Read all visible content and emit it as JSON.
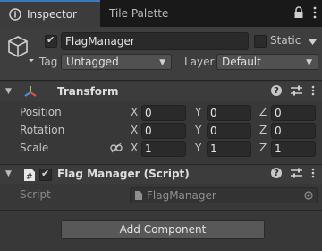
{
  "tabs": [
    {
      "label": "Inspector"
    },
    {
      "label": "Tile Palette"
    }
  ],
  "header": {
    "object_name": "FlagManager",
    "static_label": "Static",
    "tag_label": "Tag",
    "tag_value": "Untagged",
    "layer_label": "Layer",
    "layer_value": "Default"
  },
  "transform": {
    "title": "Transform",
    "rows": [
      {
        "label": "Position",
        "x": "0",
        "y": "0",
        "z": "0"
      },
      {
        "label": "Rotation",
        "x": "0",
        "y": "0",
        "z": "0"
      },
      {
        "label": "Scale",
        "x": "1",
        "y": "1",
        "z": "1"
      }
    ],
    "axis_x": "X",
    "axis_y": "Y",
    "axis_z": "Z"
  },
  "script_component": {
    "title": "Flag Manager (Script)",
    "script_label": "Script",
    "script_value": "FlagManager"
  },
  "add_component_label": "Add Component",
  "colors": {
    "accent": "#3a79bb",
    "panel": "#383838",
    "field": "#2a2a2a"
  }
}
